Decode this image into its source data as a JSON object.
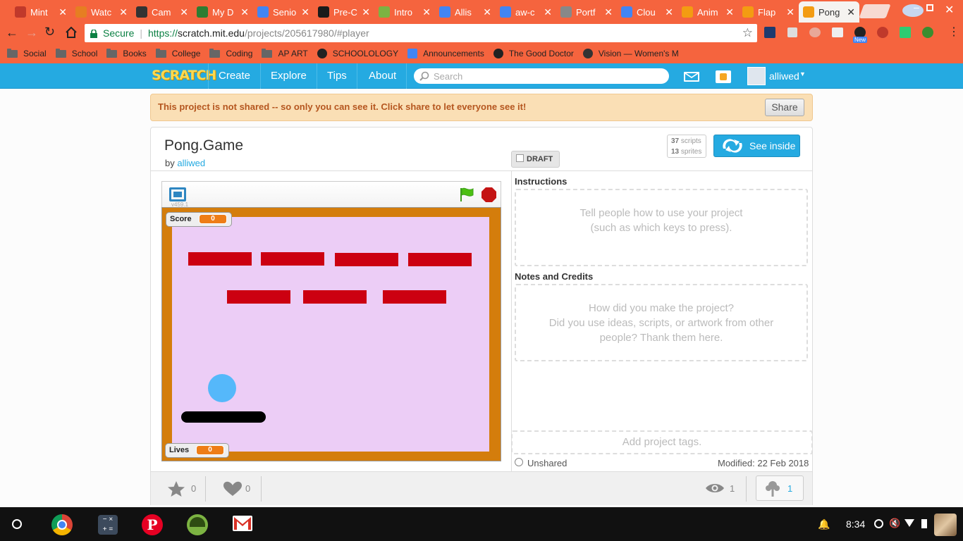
{
  "browser": {
    "tabs": [
      {
        "title": "Mint",
        "color": "#c0392b"
      },
      {
        "title": "Watc",
        "color": "#e67e22"
      },
      {
        "title": "Cam",
        "color": "#333333"
      },
      {
        "title": "My D",
        "color": "#2e7d32"
      },
      {
        "title": "Senio",
        "color": "#4285f4"
      },
      {
        "title": "Pre-C",
        "color": "#1b1b1b"
      },
      {
        "title": "Intro",
        "color": "#7cb342"
      },
      {
        "title": "Allis",
        "color": "#4285f4"
      },
      {
        "title": "aw-c",
        "color": "#4285f4"
      },
      {
        "title": "Portf",
        "color": "#888888"
      },
      {
        "title": "Clou",
        "color": "#4285f4"
      },
      {
        "title": "Anim",
        "color": "#f39c12"
      },
      {
        "title": "Flap",
        "color": "#f39c12"
      },
      {
        "title": "Pong",
        "color": "#f39c12"
      }
    ],
    "close_glyph": "✕",
    "secure_label": "Secure",
    "url_prefix": "https://",
    "url_domain": "scratch.mit.edu",
    "url_path": "/projects/205617980/#player",
    "bookmarks": [
      {
        "label": "Social",
        "icon": "folder-icon"
      },
      {
        "label": "School",
        "icon": "folder-icon"
      },
      {
        "label": "Books",
        "icon": "folder-icon"
      },
      {
        "label": "College",
        "icon": "folder-icon"
      },
      {
        "label": "Coding",
        "icon": "folder-icon"
      },
      {
        "label": "AP ART",
        "icon": "folder-icon"
      },
      {
        "label": "SCHOOLOLOGY",
        "icon": "schoology-icon"
      },
      {
        "label": "Announcements",
        "icon": "docs-icon"
      },
      {
        "label": "The Good Doctor",
        "icon": "abc-icon"
      },
      {
        "label": "Vision — Women's M",
        "icon": "wordpress-icon"
      }
    ],
    "extension_badge": "New"
  },
  "scratch_nav": {
    "logo": "SCRATCH",
    "links": [
      "Create",
      "Explore",
      "Tips",
      "About"
    ],
    "search_placeholder": "Search",
    "username": "alliwed"
  },
  "notice": {
    "text": "This project is not shared -- so only you can see it. Click share to let everyone see it!",
    "share_label": "Share"
  },
  "project": {
    "title": "Pong.Game",
    "by": "by",
    "author": "alliwed",
    "draft_label": "DRAFT",
    "scripts_count": "37",
    "scripts_label": "scripts",
    "sprites_count": "13",
    "sprites_label": "sprites",
    "see_inside_label": "See inside",
    "version": "v459.1",
    "score_label": "Score",
    "score_value": "0",
    "lives_label": "Lives",
    "lives_value": "0",
    "instructions_heading": "Instructions",
    "instructions_placeholder_1": "Tell people how to use your project",
    "instructions_placeholder_2": "(such as which keys to press).",
    "notes_heading": "Notes and Credits",
    "notes_placeholder_1": "How did you make the project?",
    "notes_placeholder_2": "Did you use ideas, scripts, or artwork from other",
    "notes_placeholder_3": "people? Thank them here.",
    "tags_placeholder": "Add project tags.",
    "share_status": "Unshared",
    "modified": "Modified: 22 Feb 2018",
    "stars": "0",
    "loves": "0",
    "views": "1",
    "remixes": "1"
  },
  "stage_colors": {
    "background": "#eccdf6",
    "border": "#d47d0c",
    "brick": "#cc0011",
    "ball": "#55b8fa",
    "paddle": "#000000"
  },
  "taskbar": {
    "time": "8:34"
  }
}
